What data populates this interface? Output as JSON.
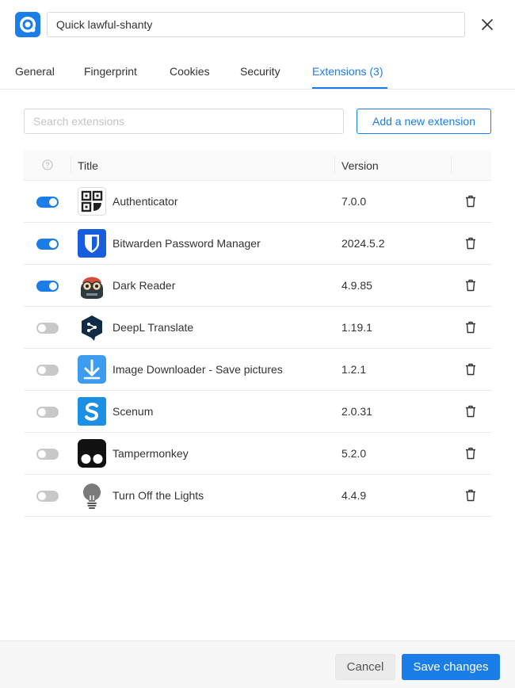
{
  "profile": {
    "name_value": "Quick lawful-shanty",
    "logo_icon": "browser-profile-logo-icon"
  },
  "tabs": [
    {
      "label": "General"
    },
    {
      "label": "Fingerprint"
    },
    {
      "label": "Cookies"
    },
    {
      "label": "Security"
    },
    {
      "label": "Extensions (3)"
    }
  ],
  "active_tab_index": 4,
  "search": {
    "placeholder": "Search extensions",
    "value": ""
  },
  "add_button_label": "Add a new extension",
  "table": {
    "columns": [
      "",
      "Title",
      "Version",
      ""
    ],
    "rows": [
      {
        "enabled": true,
        "title": "Authenticator",
        "version": "7.0.0",
        "icon": "qr-code-icon"
      },
      {
        "enabled": true,
        "title": "Bitwarden Password Manager",
        "version": "2024.5.2",
        "icon": "bitwarden-shield-icon"
      },
      {
        "enabled": true,
        "title": "Dark Reader",
        "version": "4.9.85",
        "icon": "dark-reader-icon"
      },
      {
        "enabled": false,
        "title": "DeepL Translate",
        "version": "1.19.1",
        "icon": "deepl-icon"
      },
      {
        "enabled": false,
        "title": "Image Downloader - Save pictures",
        "version": "1.2.1",
        "icon": "download-arrow-icon"
      },
      {
        "enabled": false,
        "title": "Scenum",
        "version": "2.0.31",
        "icon": "scenum-icon"
      },
      {
        "enabled": false,
        "title": "Tampermonkey",
        "version": "5.2.0",
        "icon": "tampermonkey-icon"
      },
      {
        "enabled": false,
        "title": "Turn Off the Lights",
        "version": "4.4.9",
        "icon": "light-bulb-icon"
      }
    ]
  },
  "footer": {
    "cancel_label": "Cancel",
    "save_label": "Save changes"
  },
  "colors": {
    "accent": "#1a7de8",
    "toggle_off": "#c8c8c8",
    "border": "#eaeaea"
  }
}
